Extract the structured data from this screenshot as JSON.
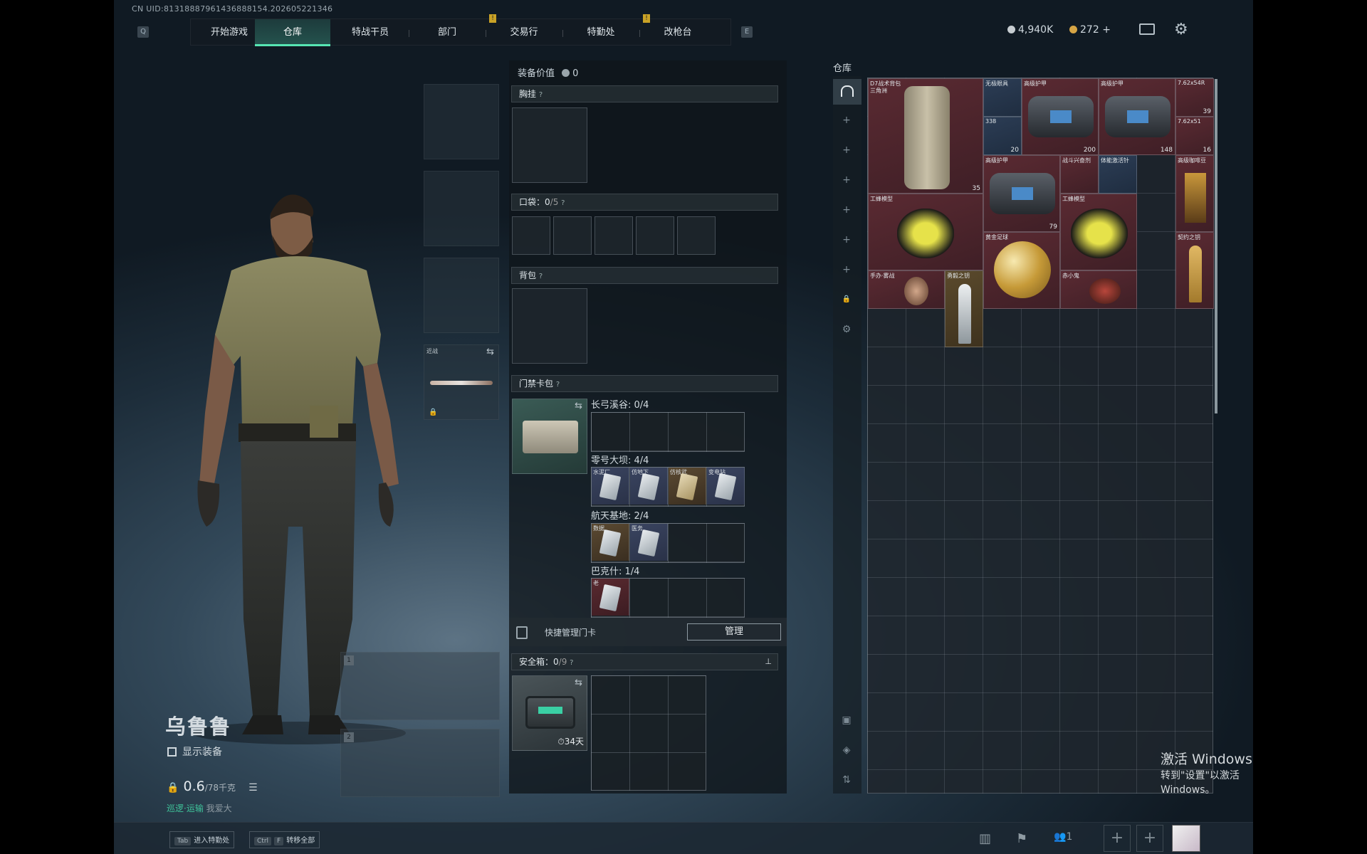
{
  "uid": "CN UID:8131888796143688815",
  "uid_suffix": "4.202605221346",
  "nav": {
    "q_key": "Q",
    "e_key": "E",
    "tabs": [
      "开始游戏",
      "仓库",
      "特战干员",
      "部门",
      "交易行",
      "特勤处",
      "改枪台"
    ],
    "active_tab": "仓库",
    "badge": "!"
  },
  "currency": {
    "silver": "4,940K",
    "gold": "272",
    "plus": "+"
  },
  "character": {
    "name": "乌鲁鲁",
    "show_gear_label": "显示装备",
    "weight_value": "0.6",
    "weight_max": "/78千克",
    "status_text": "我爱大",
    "status_prefix": "巡逻·运输"
  },
  "slots": {
    "melee_label": "近战",
    "weapon1": "1",
    "weapon2": "2"
  },
  "equipment": {
    "title": "装备价值",
    "value": "0",
    "chest": "胸挂",
    "pocket": "口袋：",
    "pocket_count": "0",
    "pocket_max": "/5",
    "backpack": "背包",
    "keycard": "门禁卡包",
    "help": "?",
    "groups": [
      {
        "name": "长弓溪谷: 0/4",
        "cards": []
      },
      {
        "name": "零号大坝: 4/4",
        "cards": [
          {
            "label": "水泥厂",
            "color": "blue"
          },
          {
            "label": "仿地下",
            "color": "blue"
          },
          {
            "label": "仿核武",
            "color": "gold"
          },
          {
            "label": "变电站",
            "color": "blue"
          }
        ]
      },
      {
        "name": "航天基地: 2/4",
        "cards": [
          {
            "label": "数据",
            "color": "gold"
          },
          {
            "label": "医务",
            "color": "blue"
          }
        ]
      },
      {
        "name": "巴克什: 1/4",
        "cards": [
          {
            "label": "老",
            "color": "red"
          }
        ]
      }
    ],
    "quick_manage": "快捷管理门卡",
    "manage_button": "管理",
    "safebox": "安全箱：",
    "safebox_count": "0",
    "safebox_max": "/9",
    "safebox_days": "34天"
  },
  "warehouse": {
    "title": "仓库",
    "items": [
      {
        "label": "D7战术背包",
        "sub": "三角洲",
        "count": "35",
        "color": "red"
      },
      {
        "label": "无极眼具",
        "count": "",
        "color": "blue"
      },
      {
        "label": "",
        "count": "338",
        "color": "blue"
      },
      {
        "label": "",
        "count": "20",
        "color": "blue"
      },
      {
        "label": "高级护甲",
        "count": "200",
        "color": "red"
      },
      {
        "label": "高级护甲",
        "count": "148",
        "color": "red"
      },
      {
        "label": "7.62x54R",
        "count": "39",
        "color": "red"
      },
      {
        "label": "7.62x51",
        "count": "16",
        "color": "red"
      },
      {
        "label": "高级护甲",
        "count": "79",
        "color": "red"
      },
      {
        "label": "战斗兴奋剂",
        "count": "",
        "color": "red"
      },
      {
        "label": "体能激活针",
        "count": "",
        "color": "blue"
      },
      {
        "label": "高级咖啡豆",
        "count": "",
        "color": "red"
      },
      {
        "label": "工蜂模型",
        "count": "",
        "color": "red"
      },
      {
        "label": "黄金足球",
        "count": "",
        "color": "red"
      },
      {
        "label": "工蜂模型",
        "count": "",
        "color": "red"
      },
      {
        "label": "契约之钥",
        "count": "",
        "color": "red"
      },
      {
        "label": "手办·雾战",
        "count": "",
        "color": "red"
      },
      {
        "label": "勇毅之钥",
        "count": "",
        "color": "gold"
      },
      {
        "label": "赤小鬼",
        "count": "",
        "color": "red"
      }
    ]
  },
  "bottom": {
    "tab_key": "Tab",
    "tab_label": "进入特勤处",
    "ctrl_key": "Ctrl",
    "f_key": "F",
    "ctrl_label": "转移全部",
    "team_count": "1"
  },
  "watermark": {
    "line1": "激活 Windows",
    "line2": "转到\"设置\"以激活 Windows。"
  },
  "colors": {
    "accent": "#56e6b3",
    "item_red": "#5a2a32",
    "item_blue": "#2c3d55",
    "item_gold": "#5b4a2c"
  }
}
